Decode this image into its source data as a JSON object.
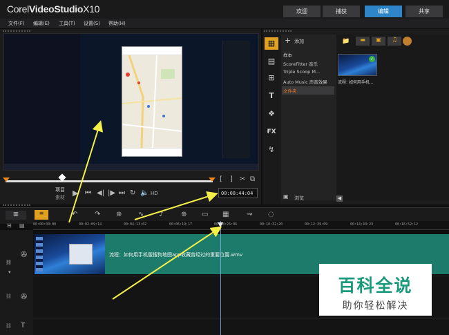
{
  "app": {
    "brand": "Corel",
    "product": "VideoStudio",
    "version": "X10"
  },
  "workspace_tabs": [
    {
      "label": "欢迎",
      "active": false
    },
    {
      "label": "捕获",
      "active": false
    },
    {
      "label": "编辑",
      "active": true
    },
    {
      "label": "共享",
      "active": false
    }
  ],
  "menu": [
    "文件(F)",
    "编辑(E)",
    "工具(T)",
    "设置(S)",
    "帮助(H)"
  ],
  "player": {
    "mode_project": "项目",
    "mode_clip": "素材",
    "hd_label": "HD",
    "timecode": "00:08:44:04",
    "bracket_in": "[",
    "bracket_out": "]"
  },
  "library": {
    "add_label": "添加",
    "items": [
      {
        "label": "样本",
        "selected": false
      },
      {
        "label": "ScoreFitter 音乐",
        "selected": false
      },
      {
        "label": "Triple Scoop M...",
        "selected": false
      },
      {
        "label": "Auto Music 声音效果",
        "selected": false
      },
      {
        "label": "文件夹",
        "selected": true
      }
    ],
    "browse_label": "浏览",
    "thumb_caption": "流程: 如何用手机..."
  },
  "timeline": {
    "ruler_ticks": [
      "00:00:00:00",
      "00:02:09:14",
      "00:04:13:02",
      "00:06:19:17",
      "00:08:26:06",
      "00:10:32:20",
      "00:12:39:09",
      "00:14:43:23",
      "00:16:52:12"
    ],
    "clip_label": "流程：如何用手机版搜狗地图app收藏曾经过的重要位置.wmv"
  },
  "watermark": {
    "title": "百科全说",
    "subtitle": "助你轻松解决"
  },
  "colors": {
    "accent_tab": "#2e86c8",
    "clip": "#1c7b6a",
    "scrub_marker": "#f08a1a",
    "annotation_arrow": "#f4f048",
    "watermark_text": "#1a9a7a"
  }
}
